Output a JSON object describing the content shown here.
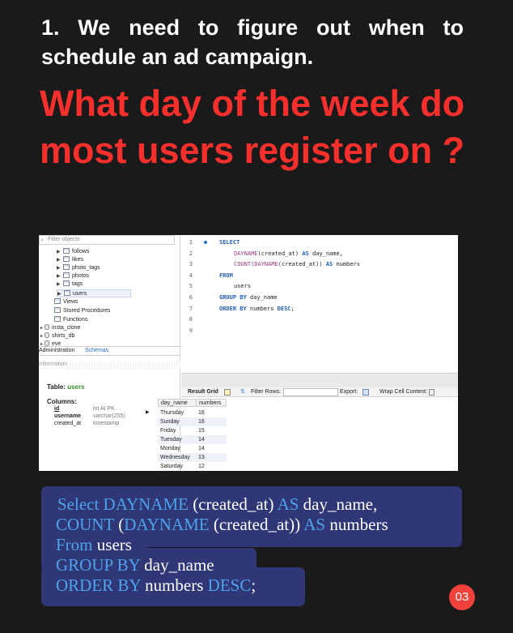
{
  "question": "1. We need to figure out when to schedule an ad campaign.",
  "headline": "What day of the week do most users register on ?",
  "workbench": {
    "filter_placeholder": "Filter objects",
    "tree": [
      "follows",
      "likes",
      "photo_tags",
      "photos",
      "tags",
      "users",
      "Views",
      "Stored Procedures",
      "Functions",
      "insta_clone",
      "shirts_db",
      "eve"
    ],
    "tabs": {
      "administration": "Administration",
      "schemas": "Schemas"
    },
    "information_label": "Information",
    "table_label": "Table:",
    "table_name": "users",
    "columns_label": "Columns:",
    "columns": [
      {
        "name": "id",
        "type": "int AI PK"
      },
      {
        "name": "username",
        "type": "varchar(255)"
      },
      {
        "name": "created_at",
        "type": "timestamp"
      }
    ],
    "line_numbers": [
      "1",
      "2",
      "3",
      "4",
      "5",
      "6",
      "7",
      "8",
      "9"
    ],
    "code": {
      "l1": "SELECT",
      "l2_fn": "DAYNAME",
      "l2_rest": "(created_at) ",
      "l2_kw": "AS",
      "l2_alias": " day_name,",
      "l3_fn": "COUNT",
      "l3_fn2": "(DAYNAME",
      "l3_rest": "(created_at)) ",
      "l3_kw": "AS",
      "l3_alias": " numbers",
      "l4": "FROM",
      "l5": "users",
      "l6_kw": "GROUP BY",
      "l6_rest": " day_name",
      "l7_kw": "ORDER BY",
      "l7_mid": " numbers ",
      "l7_kw2": "DESC",
      "l7_end": ";"
    },
    "toolbar": {
      "result_grid": "Result Grid",
      "filter_rows": "Filter Rows:",
      "export": "Export:",
      "wrap_cell": "Wrap Cell Content:"
    },
    "grid_headers": [
      "day_name",
      "numbers"
    ],
    "grid_rows": [
      [
        "Thursday",
        "16"
      ],
      [
        "Sunday",
        "16"
      ],
      [
        "Friday",
        "15"
      ],
      [
        "Tuesday",
        "14"
      ],
      [
        "Monday",
        "14"
      ],
      [
        "Wednesday",
        "13"
      ],
      [
        "Saturday",
        "12"
      ]
    ]
  },
  "snippet": {
    "l1_kw": "Select DAYNAME",
    "l1_mid": " (created_at) ",
    "l1_kw2": "AS",
    "l1_end": " day_name,",
    "l2_kw": "COUNT",
    "l2_mid1": " (",
    "l2_kw2": "DAYNAME",
    "l2_mid2": " (created_at)) ",
    "l2_kw3": "AS",
    "l2_end": " numbers",
    "l3_kw": "From",
    "l3_end": " users",
    "l4_kw": "GROUP BY",
    "l4_end": " day_name",
    "l5_kw": "ORDER BY",
    "l5_mid": " numbers ",
    "l5_kw2": "DESC",
    "l5_end": ";"
  },
  "page_number": "03",
  "colors": {
    "background": "#1b1a1a",
    "headline": "#f5302c",
    "snippet_bg": "#2f3777",
    "snippet_keyword": "#4ea3ea",
    "badge": "#f0423a"
  }
}
